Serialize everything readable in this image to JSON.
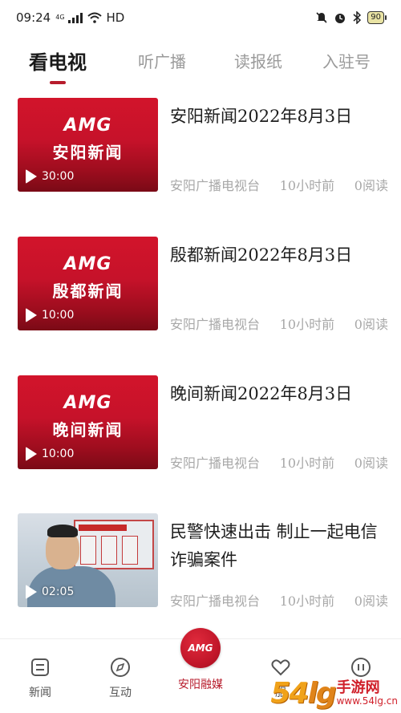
{
  "status_bar": {
    "time": "09:24",
    "network": "4G",
    "hd": "HD",
    "battery": "90",
    "icons": [
      "signal-icon",
      "wifi-icon",
      "mute-icon",
      "alarm-icon",
      "bluetooth-icon",
      "battery-icon"
    ]
  },
  "top_tabs": [
    {
      "label": "看电视",
      "active": true
    },
    {
      "label": "听广播",
      "active": false
    },
    {
      "label": "读报纸",
      "active": false
    },
    {
      "label": "入驻号",
      "active": false
    }
  ],
  "news": [
    {
      "thumb_logo": "AMG",
      "thumb_title": "安阳新闻",
      "duration": "30:00",
      "title": "安阳新闻2022年8月3日",
      "source": "安阳广播电视台",
      "time": "10小时前",
      "reads": "0阅读"
    },
    {
      "thumb_logo": "AMG",
      "thumb_title": "殷都新闻",
      "duration": "10:00",
      "title": " 殷都新闻2022年8月3日",
      "source": "安阳广播电视台",
      "time": "10小时前",
      "reads": "0阅读"
    },
    {
      "thumb_logo": "AMG",
      "thumb_title": "晚间新闻",
      "duration": "10:00",
      "title": "晚间新闻2022年8月3日",
      "source": "安阳广播电视台",
      "time": "10小时前",
      "reads": "0阅读"
    },
    {
      "thumb_caption": "",
      "duration": "02:05",
      "title": "民警快速出击 制止一起电信诈骗案件",
      "source": "安阳广播电视台",
      "time": "10小时前",
      "reads": "0阅读"
    }
  ],
  "bottom_nav": [
    {
      "label": "新闻",
      "icon": "news-icon",
      "active": false
    },
    {
      "label": "互动",
      "icon": "compass-icon",
      "active": false
    },
    {
      "label": "安阳融媒",
      "icon": "amg-logo-icon",
      "active": true,
      "badge": "AMG"
    },
    {
      "label": "服",
      "icon": "heart-icon",
      "active": false
    },
    {
      "label": "",
      "icon": "pause-icon",
      "active": false
    }
  ],
  "watermark": {
    "number": "54",
    "suffix": "lg",
    "site_cn": "手游网",
    "site_url": "www.54lg.cn"
  },
  "colors": {
    "accent": "#b71c2c",
    "thumb_red": "#c6122a",
    "meta_gray": "#a8a8a8"
  }
}
